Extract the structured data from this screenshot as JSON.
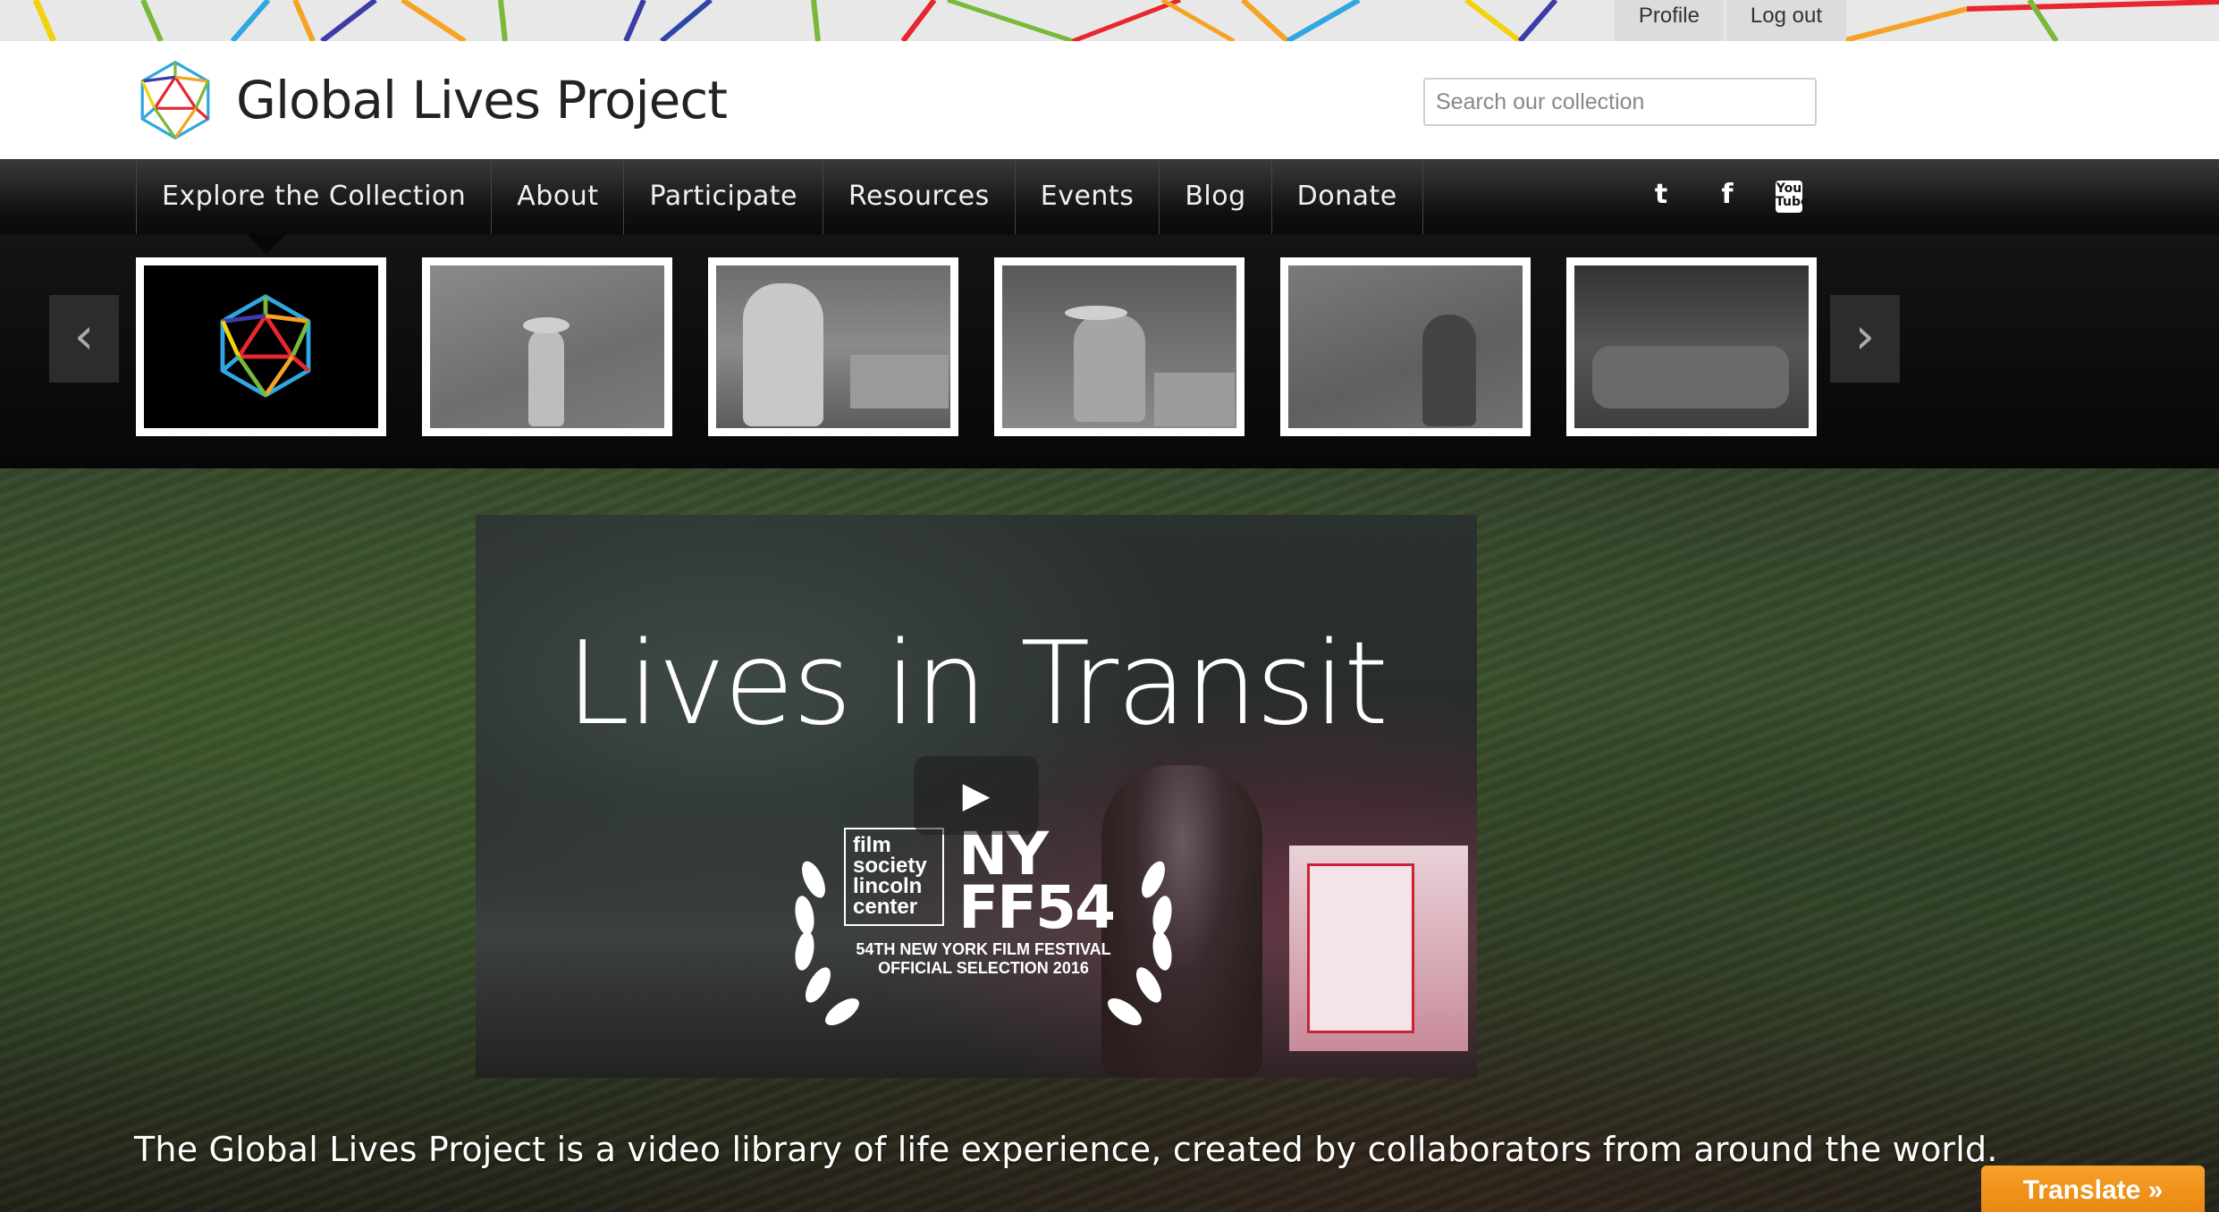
{
  "top_links": {
    "profile": "Profile",
    "logout": "Log out"
  },
  "header": {
    "site_name": "Global Lives Project",
    "search_placeholder": "Search our collection"
  },
  "nav": {
    "items": [
      "Explore the Collection",
      "About",
      "Participate",
      "Resources",
      "Events",
      "Blog",
      "Donate"
    ],
    "social": {
      "twitter": "t",
      "facebook": "f",
      "youtube": "You Tube"
    }
  },
  "carousel": {
    "prev_icon": "‹",
    "next_icon": "›",
    "thumbnails": [
      "logo-thumbnail",
      "woman-in-field",
      "seated-woman-in-hijab",
      "man-in-hat-on-steps",
      "girl-in-grass",
      "night-market"
    ]
  },
  "hero": {
    "video_title": "Lives in Transit",
    "play_icon": "▶",
    "fs_badge": "film\nsociety\nlincoln\ncenter",
    "nyff_mark": "NY\nFF54",
    "festival_text": "54TH NEW YORK FILM FESTIVAL\nOFFICIAL SELECTION 2016",
    "tagline": "The Global Lives Project is a video library of life experience, created by collaborators from around the world.",
    "translate_label": "Translate »"
  },
  "colors": {
    "orange": "#f7a12a",
    "nav_bg": "#111111",
    "header_bg": "#ffffff"
  }
}
